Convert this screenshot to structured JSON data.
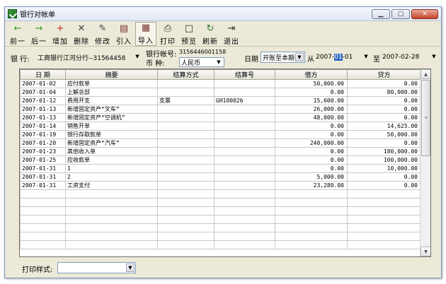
{
  "window": {
    "title": "银行对帐单"
  },
  "toolbar": [
    {
      "name": "prev-button",
      "label": "前一",
      "icon": "←",
      "color": "#2f9a2f"
    },
    {
      "name": "next-button",
      "label": "后一",
      "icon": "→",
      "color": "#2f9a2f"
    },
    {
      "name": "add-button",
      "label": "增加",
      "icon": "+",
      "color": "#c03030"
    },
    {
      "name": "delete-button",
      "label": "删除",
      "icon": "✕",
      "color": "#444"
    },
    {
      "name": "edit-button",
      "label": "修改",
      "icon": "✎",
      "color": "#444"
    },
    {
      "name": "import-button",
      "label": "引入",
      "icon": "▤",
      "color": "#7a2f2f"
    },
    {
      "name": "export-button",
      "label": "导入",
      "icon": "▦",
      "color": "#7a2f2f"
    },
    {
      "name": "print-button",
      "label": "打印",
      "icon": "⎙",
      "color": "#333"
    },
    {
      "name": "preview-button",
      "label": "预览",
      "icon": "□",
      "color": "#333"
    },
    {
      "name": "refresh-button",
      "label": "刷新",
      "icon": "↻",
      "color": "#2f7a2f"
    },
    {
      "name": "exit-button",
      "label": "退出",
      "icon": "⇥",
      "color": "#333"
    }
  ],
  "filters": {
    "bank_label": "银  行:",
    "bank_value": "工商银行江河分行--31564458",
    "account_label": "银行帐号:",
    "account_value": "3156446001158",
    "currency_label": "币    种:",
    "currency_value": "人民币",
    "date_label": "日期",
    "date_mode": "开账至本期",
    "from_label": "从",
    "from_date_prefix": "2007-",
    "from_date_selected": "01",
    "from_date_suffix": "-01",
    "to_label": "至",
    "to_date": "2007-02-28"
  },
  "table": {
    "columns": [
      "日    期",
      "摘要",
      "结算方式",
      "结算号",
      "借方",
      "贷方"
    ],
    "rows": [
      [
        "2007-01-02",
        "应付款单",
        "",
        "",
        "50,000.00",
        "0.00"
      ],
      [
        "2007-01-04",
        "上解总部",
        "",
        "",
        "0.00",
        "80,000.00"
      ],
      [
        "2007-01-12",
        "费用开支",
        "支票",
        "GH100026",
        "15,600.00",
        "0.00"
      ],
      [
        "2007-01-13",
        "新增固定资产“叉车”",
        "",
        "",
        "26,000.00",
        "0.00"
      ],
      [
        "2007-01-13",
        "新增固定资产“空调机”",
        "",
        "",
        "48,000.00",
        "0.00"
      ],
      [
        "2007-01-14",
        "销售开单",
        "",
        "",
        "0.00",
        "14,625.00"
      ],
      [
        "2007-01-19",
        "银行存取款单",
        "",
        "",
        "0.00",
        "50,000.00"
      ],
      [
        "2007-01-20",
        "新增固定资产“汽车”",
        "",
        "",
        "240,000.00",
        "0.00"
      ],
      [
        "2007-01-23",
        "其他收入单",
        "",
        "",
        "0.00",
        "180,000.00"
      ],
      [
        "2007-01-25",
        "应收款单",
        "",
        "",
        "0.00",
        "100,000.00"
      ],
      [
        "2007-01-31",
        "1",
        "",
        "",
        "0.00",
        "10,000.00"
      ],
      [
        "2007-01-31",
        "2",
        "",
        "",
        "5,000.00",
        "0.00"
      ],
      [
        "2007-01-31",
        "工资支付",
        "",
        "",
        "23,280.00",
        "0.00"
      ]
    ],
    "empty_rows": 7
  },
  "print": {
    "label": "打印样式:",
    "value": ""
  }
}
